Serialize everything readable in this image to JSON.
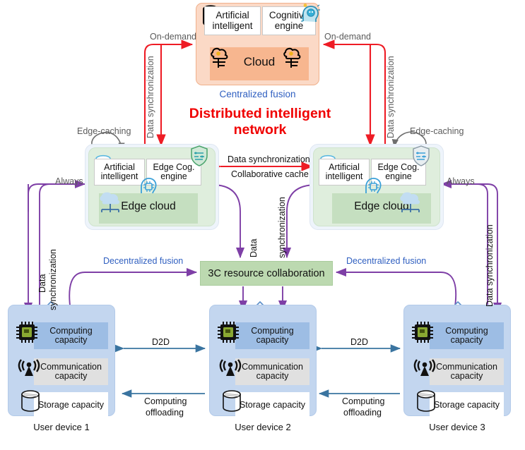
{
  "title": {
    "main": "Distributed intelligent\nnetwork",
    "main_line1": "Distributed intelligent",
    "main_line2": "network",
    "color": "#f00000"
  },
  "cloud": {
    "ai_label": "Artificial\nintelligent",
    "ai_line1": "Artificial",
    "ai_line2": "intelligent",
    "cognitive_label": "Cognitive\nengine",
    "cognitive_line1": "Cognitive",
    "cognitive_line2": "engine",
    "inner_label": "Cloud",
    "caption": "Centralized fusion",
    "caption_color": "#2f5fc0",
    "fill": "#fbd9c6",
    "inner_fill": "#f7b68f",
    "icons": [
      "database-icon",
      "brain-head-icon",
      "cloud-tree-icon-left",
      "cloud-tree-icon-right"
    ]
  },
  "edge_clouds": [
    {
      "side": "left",
      "ai_line1": "Artificial",
      "ai_line2": "intelligent",
      "cognitive_line1": "Edge Cog.",
      "cognitive_line2": "engine",
      "inner_label": "Edge cloud",
      "caching_label": "Edge-caching",
      "always_label": "Always",
      "icons": [
        "database-icon",
        "shield-circuit-icon",
        "ai-head-icon",
        "cloud-network-icon"
      ]
    },
    {
      "side": "right",
      "ai_line1": "Artificial",
      "ai_line2": "intelligent",
      "cognitive_line1": "Edge Cog.",
      "cognitive_line2": "engine",
      "inner_label": "Edge cloud",
      "caching_label": "Edge-caching",
      "always_label": "Always",
      "icons": [
        "database-icon",
        "shield-circuit-icon",
        "ai-head-icon",
        "cloud-network-icon"
      ]
    }
  ],
  "edge_link": {
    "top_label": "Data synchronization",
    "bottom_label": "Collaborative cache",
    "color": "#ee1c25"
  },
  "collaboration": {
    "label": "3C resource collaboration",
    "fill": "#bcd9b0",
    "left_arrow_label": "Decentralized fusion",
    "right_arrow_label": "Decentralized fusion",
    "center_label_line1": "Data",
    "center_label_line2": "synchronization"
  },
  "cloud_links": {
    "left_top_label": "On-demand",
    "right_top_label": "On-demand",
    "left_vertical_label": "Data synchronization",
    "right_vertical_label": "Data synchronization",
    "color": "#ee1c25"
  },
  "edge_device_links": {
    "left_vertical_line1": "Data",
    "left_vertical_line2": "synchronization",
    "right_vertical_label": "Data synchronization",
    "color": "#7e3fa6"
  },
  "devices": [
    {
      "name": "User device 1",
      "capacities": [
        {
          "label_line1": "Computing",
          "label_line2": "capacity",
          "icon": "cpu-chip-icon",
          "fill": "#9dbde4"
        },
        {
          "label_line1": "Communication",
          "label_line2": "capacity",
          "icon": "antenna-icon",
          "fill": "#e0e0e0"
        },
        {
          "label_line1": "Storage capacity",
          "label_line2": "",
          "icon": "storage-cylinder-icon",
          "fill": "#ffffff"
        }
      ],
      "hollow_arrows": [
        "up",
        "right"
      ]
    },
    {
      "name": "User device 2",
      "capacities": [
        {
          "label_line1": "Computing",
          "label_line2": "capacity",
          "icon": "cpu-chip-icon",
          "fill": "#9dbde4"
        },
        {
          "label_line1": "Communication",
          "label_line2": "capacity",
          "icon": "antenna-icon",
          "fill": "#e0e0e0"
        },
        {
          "label_line1": "Storage capacity",
          "label_line2": "",
          "icon": "storage-cylinder-icon",
          "fill": "#ffffff"
        }
      ],
      "hollow_arrows": [
        "left",
        "up",
        "right"
      ]
    },
    {
      "name": "User device 3",
      "capacities": [
        {
          "label_line1": "Computing",
          "label_line2": "capacity",
          "icon": "cpu-chip-icon",
          "fill": "#9dbde4"
        },
        {
          "label_line1": "Communication",
          "label_line2": "capacity",
          "icon": "antenna-icon",
          "fill": "#e0e0e0"
        },
        {
          "label_line1": "Storage capacity",
          "label_line2": "",
          "icon": "storage-cylinder-icon",
          "fill": "#ffffff"
        }
      ],
      "hollow_arrows": [
        "left",
        "up"
      ]
    }
  ],
  "device_links": [
    {
      "top_label": "D2D",
      "bottom_line1": "Computing",
      "bottom_line2": "offloading",
      "color": "#3a74a0"
    },
    {
      "top_label": "D2D",
      "bottom_line1": "Computing",
      "bottom_line2": "offloading",
      "color": "#3a74a0"
    }
  ],
  "colors": {
    "red_arrow": "#ee1c25",
    "purple_arrow": "#7e3fa6",
    "blue_arrow": "#3a74a0",
    "gray_arc": "#6e6e6e",
    "label_gray": "#5b5b5b",
    "blue_text": "#2f5fc0"
  }
}
